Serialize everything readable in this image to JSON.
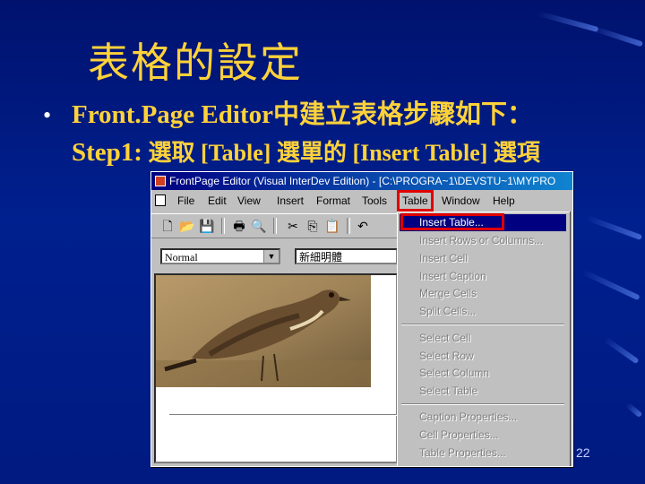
{
  "slide": {
    "title": "表格的設定",
    "bullet": "•",
    "line1": "Front.Page Editor中建立表格步驟如下：",
    "step_label": "Step1:",
    "step_text": " 選取 [Table] 選單的 [Insert Table] 選項",
    "page_number": "22"
  },
  "window": {
    "title": "FrontPage Editor (Visual InterDev Edition) - [C:\\PROGRA~1\\DEVSTU~1\\MYPRO",
    "menus": [
      "File",
      "Edit",
      "View",
      "Insert",
      "Format",
      "Tools",
      "Table",
      "Window",
      "Help"
    ],
    "toolbar_icons": [
      "new-icon",
      "open-icon",
      "save-icon",
      "print-icon",
      "print-preview-icon",
      "cut-icon",
      "copy-icon",
      "paste-icon",
      "undo-icon"
    ],
    "style_value": "Normal",
    "font_value": "新細明體"
  },
  "table_menu": {
    "items": [
      "Insert Table...",
      "Insert Rows or Columns...",
      "Insert Cell",
      "Insert Caption",
      "Merge Cells",
      "Split Cells...",
      "Select Cell",
      "Select Row",
      "Select Column",
      "Select Table",
      "Caption Properties...",
      "Cell Properties...",
      "Table Properties..."
    ],
    "highlighted": "Insert Table..."
  },
  "colors": {
    "background": "#00157a",
    "text_accent": "#ffd23a",
    "highlight_box": "#e00000",
    "menu_selection": "#000080"
  }
}
